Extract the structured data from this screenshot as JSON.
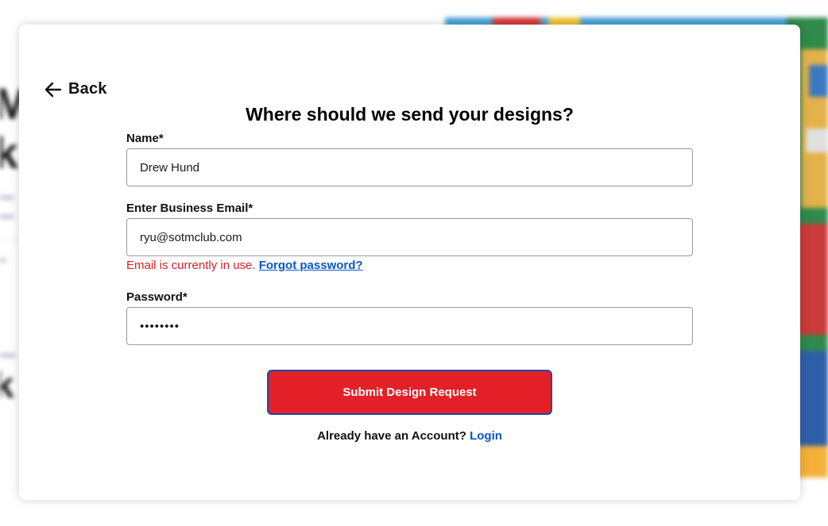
{
  "background": {
    "letters": [
      "M",
      "k",
      "k"
    ]
  },
  "modal": {
    "back_label": "Back",
    "title": "Where should we send your designs?",
    "name_field": {
      "label": "Name*",
      "value": "Drew Hund"
    },
    "email_field": {
      "label": "Enter Business Email*",
      "value": "ryu@sotmclub.com"
    },
    "email_error": {
      "message": "Email is currently in use.",
      "forgot_link": "Forgot password?"
    },
    "password_field": {
      "label": "Password*",
      "value": "••••••••"
    },
    "submit_label": "Submit Design Request",
    "login_prompt": "Already have an Account?",
    "login_link": "Login"
  },
  "colors": {
    "submit_bg": "#e32028",
    "submit_border": "#1e4ba8",
    "error": "#d92027",
    "link": "#0a56c6"
  }
}
